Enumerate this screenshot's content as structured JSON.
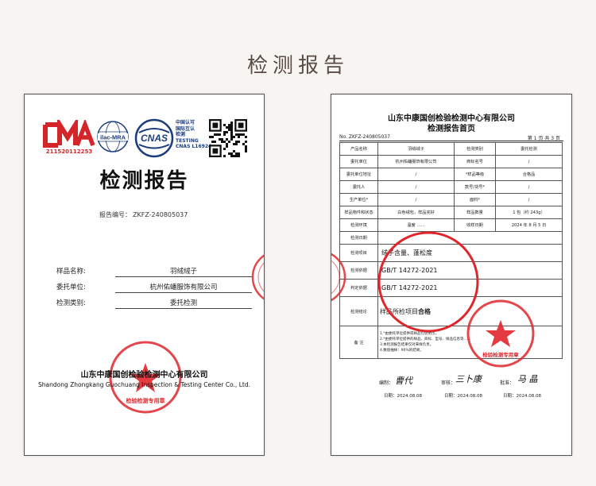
{
  "page": {
    "title": "检测报告"
  },
  "cover": {
    "cma_number": "211520112253",
    "ilac_label": "ilac-MRA",
    "cnas_logo": "CNAS",
    "cnas_text": [
      "中国认可",
      "国际互认",
      "检测",
      "TESTING",
      "CNAS L16924"
    ],
    "title": "检测报告",
    "report_no_label": "报告编号：",
    "report_no": "ZKFZ-240805037",
    "fields": [
      {
        "label": "样品名称:",
        "value": "羽绒绒子"
      },
      {
        "label": "委托单位:",
        "value": "杭州佑蟠服饰有限公司"
      },
      {
        "label": "检测类别:",
        "value": "委托检测"
      }
    ],
    "org_cn": "山东中康国创检验检测中心有限公司",
    "org_en": "Shandong Zhongkang Guochuang Inspection & Testing Center Co., Ltd.",
    "stamp_text": "检验检测专用章"
  },
  "first_page": {
    "org": "山东中康国创检验检测中心有限公司",
    "title": "检测报告首页",
    "no_label": "No.",
    "no": "ZKFZ-240805037",
    "page_info": "第 1 页 共 3 页",
    "rows": [
      [
        "产品名称",
        "羽绒绒子",
        "检测类别",
        "委托检测"
      ],
      [
        "委托单位",
        "杭州佑蟠服饰有限公司",
        "商标名号",
        "/"
      ],
      [
        "委托单位地址",
        "/",
        "*样品等级",
        "合格品"
      ],
      [
        "委托人",
        "/",
        "款号/货号*",
        "/"
      ],
      [
        "生产单位*",
        "/",
        "面料*",
        "/"
      ],
      [
        "样品物件和状态",
        "白色绒包，样品完好",
        "样品数量",
        "1 包（约 243g）"
      ],
      [
        "检测环境",
        "温度 ……",
        "收样日期",
        "2024 年 8 月 5 日"
      ]
    ],
    "test_date_label": "检测日期",
    "items_label": "检测项目",
    "items_value": "绒子含量、蓬松度",
    "basis_label": "检测依据",
    "basis_value": "GB/T 14272-2021",
    "judge_label": "判定依据",
    "judge_value": "GB/T 14272-2021",
    "conclusion_label": "检测结论",
    "conclusion_prefix": "样品所检项目",
    "conclusion_bold": "合格",
    "notes_label": "备  注",
    "notes": [
      "1.*由委托单位提供或样品包装明示。",
      "2.*由委托单位提供的样品、商标、型号、样品信息等……",
      "3.本检测报告结果仅对来样负责。",
      "4.数值抽样：90%的结果。"
    ],
    "sig_label_1": "编制：",
    "sig_label_2": "审核：",
    "sig_label_3": "批准：",
    "sig_1": "曹代",
    "sig_2": "三卜康",
    "sig_3": "马 晶",
    "date_label": "日期：",
    "date_1": "2024.08.08",
    "date_2": "2024.08.08",
    "date_3": "2024.08.08",
    "stamp_text": "检验检测专用章"
  },
  "colors": {
    "stamp": "#e0262b",
    "circle": "#e0262b",
    "cnas_blue": "#1c3d7d",
    "title_text": "#5a4c44"
  }
}
